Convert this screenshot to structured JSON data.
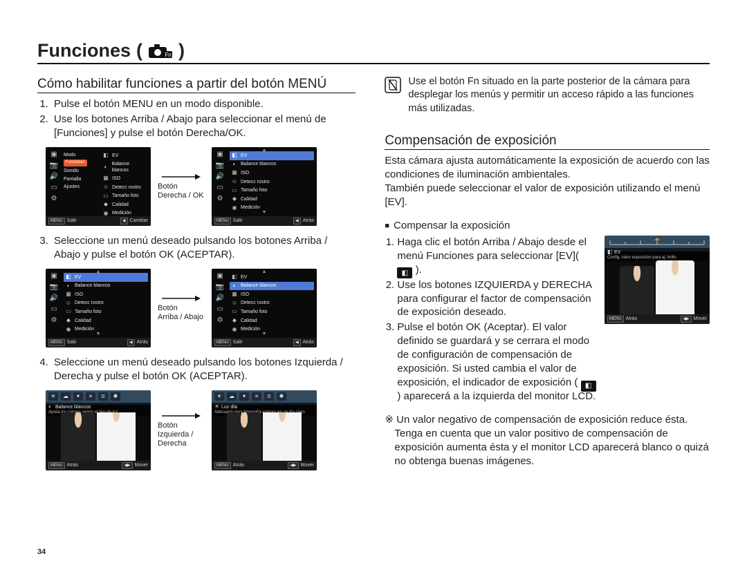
{
  "page_number": "34",
  "title": "Funciones",
  "left": {
    "section_title": "Cómo habilitar funciones a partir del botón MENÚ",
    "step1": "Pulse el botón MENU en un modo disponible.",
    "step2": "Use los botones Arriba / Abajo para seleccionar el menú de [Funciones] y pulse el botón Derecha/OK.",
    "step3": "Seleccione un menú deseado pulsando los botones Arriba / Abajo y pulse el botón OK (ACEPTAR).",
    "step4": "Seleccione un menú deseado pulsando los botones Izquierda / Derecha y pulse el botón OK (ACEPTAR).",
    "arrow1_l1": "Botón",
    "arrow1_l2": "Derecha / OK",
    "arrow2_l1": "Botón",
    "arrow2_l2": "Arriba / Abajo",
    "arrow3_l1": "Botón",
    "arrow3_l2": "Izquierda /",
    "arrow3_l3": "Derecha",
    "menu_left": {
      "items": [
        "Modo",
        "Funciones",
        "Sonido",
        "Pantalla",
        "Ajustes"
      ],
      "highlight": "Funciones"
    },
    "menu_right": {
      "items": [
        "EV",
        "Balance blancos",
        "ISO",
        "Detecc rostro",
        "Tamaño foto",
        "Calidad",
        "Medición"
      ],
      "highlight": "EV"
    },
    "footer_exit": "Salir",
    "footer_change": "Cambiar",
    "footer_back": "Atrás",
    "footer_move": "Mover",
    "chip_menu": "MENU",
    "photo_a_title": "Balance blancos",
    "photo_a_sub": "Ajusta los colores según el tipo de luz",
    "photo_b_title": "Luz día",
    "photo_b_sub": "Adecuado para fotografía exterior en un día claro"
  },
  "right": {
    "note_text": "Use el botón Fn situado en la parte posterior de la cámara para desplegar los menús y permitir un acceso rápido a las funciones más utilizadas.",
    "section_title": "Compensación de exposición",
    "para1": "Esta cámara ajusta automáticamente la exposición de acuerdo con las condiciones de iluminación ambientales.",
    "para2": "También puede seleccionar el valor de exposición utilizando el menú [EV].",
    "bullet": "Compensar la exposición",
    "s1a": "Haga clic el botón Arriba / Abajo desde el menú Funciones para seleccionar",
    "s1b": "[EV](",
    "s1c": ").",
    "s2": "Use los botones IZQUIERDA y DERECHA para configurar el factor de compensación de exposición deseado.",
    "s3a": "Pulse el botón OK (Aceptar). El valor definido se guardará y se cerrara el modo de configuración de compensación de exposición. Si usted cambia el valor de exposición, el indicador de exposición (",
    "s3b": ")  aparecerá a la izquierda del monitor LCD.",
    "note2": "Un valor negativo de compensación de exposición reduce ésta. Tenga en cuenta que un valor positivo de compensación de exposición aumenta ésta y el monitor LCD aparecerá blanco o quizá no obtenga buenas imágenes.",
    "ev_screen_title": "EV",
    "ev_screen_sub": "Config. valor exposición para aj. brillo",
    "footer_back": "Atrás",
    "footer_move": "Mover",
    "chip_menu": "MENU"
  }
}
